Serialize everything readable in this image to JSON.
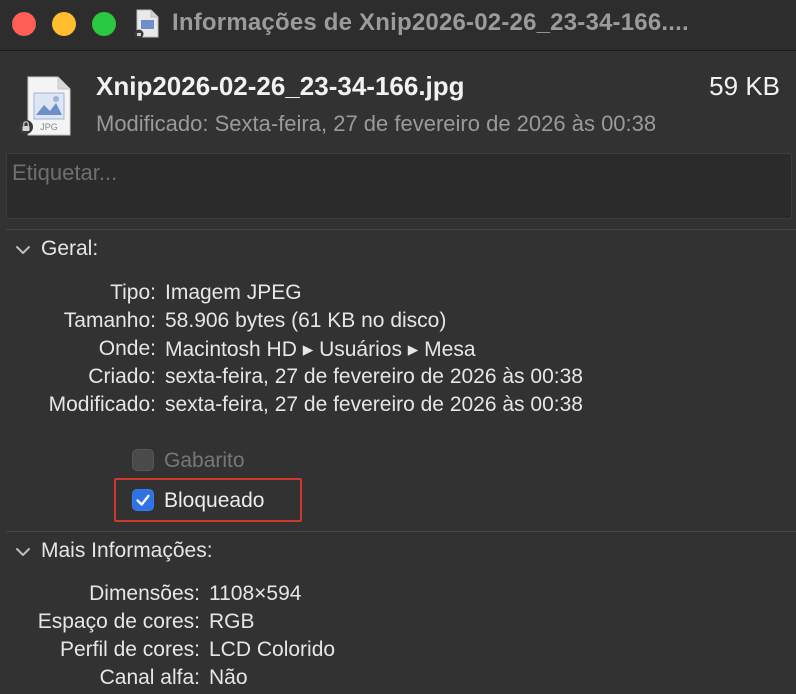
{
  "window": {
    "title": "Informações de Xnip2026-02-26_23-34-166...."
  },
  "file": {
    "name": "Xnip2026-02-26_23-34-166.jpg",
    "size": "59 KB",
    "modified_line": "Modificado: Sexta-feira, 27 de fevereiro de 2026 às 00:38",
    "icon_label": "JPG"
  },
  "tags": {
    "placeholder": "Etiquetar..."
  },
  "general": {
    "title": "Geral:",
    "rows": [
      {
        "key": "Tipo:",
        "value": "Imagem JPEG"
      },
      {
        "key": "Tamanho:",
        "value": "58.906 bytes (61 KB no disco)"
      },
      {
        "key": "Onde:",
        "value": "Macintosh HD ▸ Usuários ▸ Mesa"
      },
      {
        "key": "Criado:",
        "value": "sexta-feira, 27 de fevereiro de 2026 às 00:38"
      },
      {
        "key": "Modificado:",
        "value": "sexta-feira, 27 de fevereiro de 2026 às 00:38"
      }
    ],
    "stationery": {
      "label": "Gabarito",
      "checked": false,
      "enabled": false
    },
    "locked": {
      "label": "Bloqueado",
      "checked": true,
      "enabled": true
    }
  },
  "more_info": {
    "title": "Mais Informações:",
    "rows": [
      {
        "key": "Dimensões:",
        "value": "1108×594"
      },
      {
        "key": "Espaço de cores:",
        "value": "RGB"
      },
      {
        "key": "Perfil de cores:",
        "value": "LCD Colorido"
      },
      {
        "key": "Canal alfa:",
        "value": "Não"
      }
    ]
  },
  "colors": {
    "close": "#ff5f57",
    "minimize": "#febc2e",
    "maximize": "#28c840",
    "checkbox_accent": "#2e72e6",
    "highlight": "#d0382b"
  },
  "icons": [
    "document-icon",
    "lock-icon",
    "chevron-down-icon",
    "checkmark-icon"
  ]
}
